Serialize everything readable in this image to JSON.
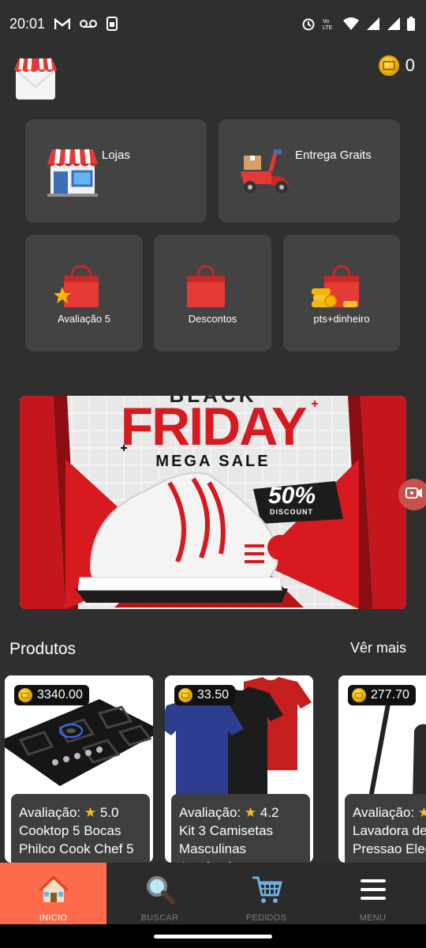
{
  "status_bar": {
    "time": "20:01",
    "icons": [
      "gmail-icon",
      "voicemail-icon",
      "sim-app-icon",
      "alarm-icon",
      "volte-icon",
      "wifi-icon",
      "signal-icon",
      "signal-icon",
      "battery-icon"
    ]
  },
  "header": {
    "logo_icon": "store-logo-icon",
    "coin_balance": "0"
  },
  "categories": {
    "big": [
      {
        "label": "Lojas",
        "icon": "store-icon"
      },
      {
        "label": "Entrega Graits",
        "icon": "scooter-icon"
      }
    ],
    "small": [
      {
        "label": "Avaliação 5",
        "icon": "bag-star-icon"
      },
      {
        "label": "Descontos",
        "icon": "bag-icon"
      },
      {
        "label": "pts+dinheiro",
        "icon": "bag-coins-icon"
      }
    ]
  },
  "banner": {
    "line1": "BLACK",
    "line2": "FRIDAY",
    "line3": "MEGA SALE",
    "discount": "50%",
    "discount_sub": "DISCOUNT"
  },
  "products_section": {
    "title": "Produtos",
    "see_more": "Vêr mais"
  },
  "products": [
    {
      "price": "3340.00",
      "rating_label": "Avaliação:",
      "rating": "5.0",
      "name_line1": "Cooktop 5 Bocas",
      "name_line2": "Philco Cook Chef 5"
    },
    {
      "price": "33.50",
      "rating_label": "Avaliação:",
      "rating": "4.2",
      "name_line1": "Kit 3 Camisetas",
      "name_line2": "Masculinas Academia"
    },
    {
      "price": "277.70",
      "rating_label": "Avaliação:",
      "rating": "",
      "name_line1": "Lavadora de",
      "name_line2": "Pressao Elec"
    }
  ],
  "bottom_nav": [
    {
      "label": "INICIO",
      "icon": "home-icon",
      "active": true
    },
    {
      "label": "BUSCAR",
      "icon": "magnifier-icon",
      "active": false
    },
    {
      "label": "PEDIDOS",
      "icon": "cart-icon",
      "active": false
    },
    {
      "label": "MENU",
      "icon": "hamburger-icon",
      "active": false
    }
  ],
  "colors": {
    "background": "#2f2f2f",
    "tile": "#434343",
    "accent": "#ff6a4d",
    "coin": "#f0b400"
  }
}
